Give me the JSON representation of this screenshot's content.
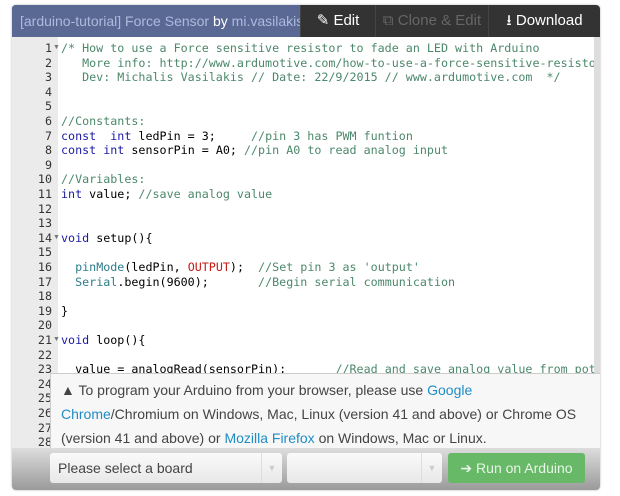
{
  "header": {
    "project": "[arduino-tutorial] Force Sensor",
    "by": "by",
    "author": "mi.vasilakis",
    "edit": "Edit",
    "clone": "Clone & Edit",
    "download": "Download"
  },
  "code": {
    "line_numbers": [
      "1",
      "2",
      "3",
      "4",
      "5",
      "6",
      "7",
      "8",
      "9",
      "10",
      "11",
      "12",
      "13",
      "14",
      "15",
      "16",
      "17",
      "18",
      "19",
      "20",
      "21",
      "22",
      "23",
      "24",
      "25",
      "26",
      "27",
      "28"
    ],
    "folds": [
      1,
      14,
      21
    ],
    "lines": [
      [
        [
          "cm",
          "/* How to use a Force sensitive resistor to fade an LED with Arduino"
        ]
      ],
      [
        [
          "cm",
          "   More info: http://www.ardumotive.com/how-to-use-a-force-sensitive-resisto"
        ]
      ],
      [
        [
          "cm",
          "   Dev: Michalis Vasilakis // Date: 22/9/2015 // www.ardumotive.com  */"
        ]
      ],
      [],
      [],
      [
        [
          "cm",
          "//Constants:"
        ]
      ],
      [
        [
          "kw",
          "const"
        ],
        [
          "",
          "  "
        ],
        [
          "kw",
          "int"
        ],
        [
          "",
          " ledPin = 3;     "
        ],
        [
          "cm",
          "//pin 3 has PWM funtion"
        ]
      ],
      [
        [
          "kw",
          "const"
        ],
        [
          "",
          " "
        ],
        [
          "kw",
          "int"
        ],
        [
          "",
          " sensorPin = A0; "
        ],
        [
          "cm",
          "//pin A0 to read analog input"
        ]
      ],
      [],
      [
        [
          "cm",
          "//Variables:"
        ]
      ],
      [
        [
          "kw",
          "int"
        ],
        [
          "",
          " value; "
        ],
        [
          "cm",
          "//save analog value"
        ]
      ],
      [],
      [],
      [
        [
          "kw",
          "void"
        ],
        [
          "",
          " setup(){"
        ]
      ],
      [],
      [
        [
          "",
          "  "
        ],
        [
          "fn",
          "pinMode"
        ],
        [
          "",
          "(ledPin, "
        ],
        [
          "cn",
          "OUTPUT"
        ],
        [
          "",
          ");  "
        ],
        [
          "cm",
          "//Set pin 3 as 'output'"
        ]
      ],
      [
        [
          "",
          "  "
        ],
        [
          "fn",
          "Serial"
        ],
        [
          "",
          ".begin(9600);       "
        ],
        [
          "cm",
          "//Begin serial communication"
        ]
      ],
      [],
      [
        [
          "",
          "}"
        ]
      ],
      [],
      [
        [
          "kw",
          "void"
        ],
        [
          "",
          " loop(){"
        ]
      ],
      [],
      [
        [
          "",
          "  value = analogRead(sensorPin);       "
        ],
        [
          "cm",
          "//Read and save analog value from pot"
        ]
      ]
    ]
  },
  "notice": {
    "icon": "warning-icon",
    "t1": " To program your Arduino from your browser, please use ",
    "chrome": "Google Chrome",
    "t2": "/Chromium on Windows, Mac, Linux (version 41 and above) or Chrome OS (version 41 and above) or ",
    "firefox": "Mozilla Firefox",
    "t3": " on Windows, Mac or Linux."
  },
  "bottom": {
    "board_placeholder": "Please select a board",
    "port_value": "",
    "run": "Run on Arduino"
  }
}
